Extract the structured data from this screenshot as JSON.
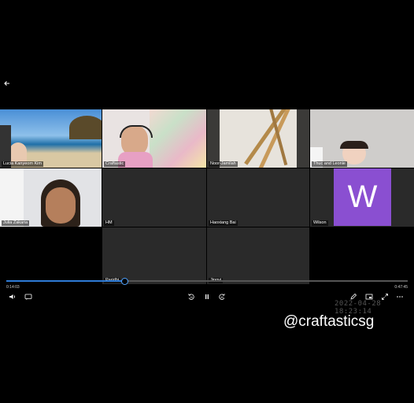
{
  "participants": [
    {
      "name": "Lucia Kanyeom Kim"
    },
    {
      "name": "Craftastic"
    },
    {
      "name": "Noor-Jamilah"
    },
    {
      "name": "Thuc and Leonie"
    },
    {
      "name": "Julia Zakaria"
    },
    {
      "name": "HM"
    },
    {
      "name": "Haoxiang Bai"
    },
    {
      "name": "Wilson"
    },
    {
      "name": "Paridhi"
    },
    {
      "name": "Jingyi"
    }
  ],
  "wilson_avatar_letter": "W",
  "player": {
    "current_time": "0:14:03",
    "total_time": "0:47:45",
    "progress_fraction": 0.294,
    "rewind_label": "10",
    "forward_label": "30"
  },
  "recording_timestamp": "2022-04-28  18:23:14",
  "watermark": "@craftasticsg",
  "colors": {
    "progress": "#2e7bd6",
    "avatar": "#8a4fd1"
  }
}
